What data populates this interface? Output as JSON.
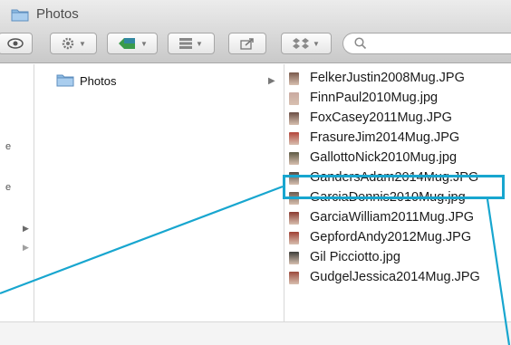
{
  "window": {
    "title": "Photos"
  },
  "toolbar": {
    "eye_icon": "eye-icon",
    "action_icon": "gear-icon",
    "tag_icon": "tag-icon",
    "arrange_icon": "grid-icon",
    "share_icon": "share-icon",
    "dropbox_icon": "dropbox-icon",
    "search_icon": "search-icon"
  },
  "column2": {
    "folder_label": "Photos"
  },
  "files": [
    {
      "name": "FelkerJustin2008Mug.JPG",
      "thumb": "#7a5a4c"
    },
    {
      "name": "FinnPaul2010Mug.jpg",
      "thumb": "#c9a9a0"
    },
    {
      "name": "FoxCasey2011Mug.JPG",
      "thumb": "#6a4e44"
    },
    {
      "name": "FrasureJim2014Mug.JPG",
      "thumb": "#b3453a"
    },
    {
      "name": "GallottoNick2010Mug.jpg",
      "thumb": "#5e5a44"
    },
    {
      "name": "GandersAdam2014Mug.JPG",
      "thumb": "#4f4a44"
    },
    {
      "name": "GarciaDennis2010Mug.jpg",
      "thumb": "#6b5a4e"
    },
    {
      "name": "GarciaWilliam2011Mug.JPG",
      "thumb": "#8a3a30"
    },
    {
      "name": "GepfordAndy2012Mug.JPG",
      "thumb": "#a04034"
    },
    {
      "name": "Gil Picciotto.jpg",
      "thumb": "#3e3e3a"
    },
    {
      "name": "GudgelJessica2014Mug.JPG",
      "thumb": "#9c4a3c"
    }
  ],
  "colors": {
    "highlight": "#18a6cf",
    "folder": "#7fb3de"
  }
}
